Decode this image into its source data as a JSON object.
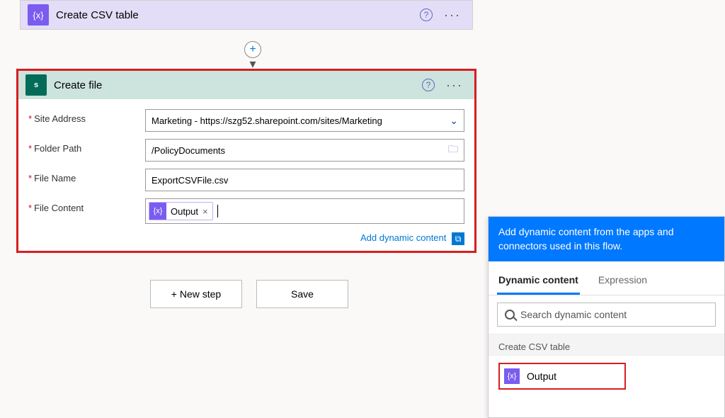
{
  "csv_card": {
    "title": "Create CSV table",
    "icon_glyph": "{x}"
  },
  "file_card": {
    "title": "Create file",
    "icon_glyph": "s",
    "fields": {
      "site_address": {
        "label": "Site Address",
        "value": "Marketing - https://szg52.sharepoint.com/sites/Marketing"
      },
      "folder_path": {
        "label": "Folder Path",
        "value": "/PolicyDocuments"
      },
      "file_name": {
        "label": "File Name",
        "value": "ExportCSVFile.csv"
      },
      "file_content": {
        "label": "File Content",
        "token_label": "Output"
      }
    },
    "add_dynamic_link": "Add dynamic content"
  },
  "buttons": {
    "new_step": "+ New step",
    "save": "Save"
  },
  "dyn_panel": {
    "heading": "Add dynamic content from the apps and connectors used in this flow.",
    "tabs": {
      "dynamic": "Dynamic content",
      "expression": "Expression"
    },
    "search_placeholder": "Search dynamic content",
    "group_title": "Create CSV table",
    "item_label": "Output"
  }
}
